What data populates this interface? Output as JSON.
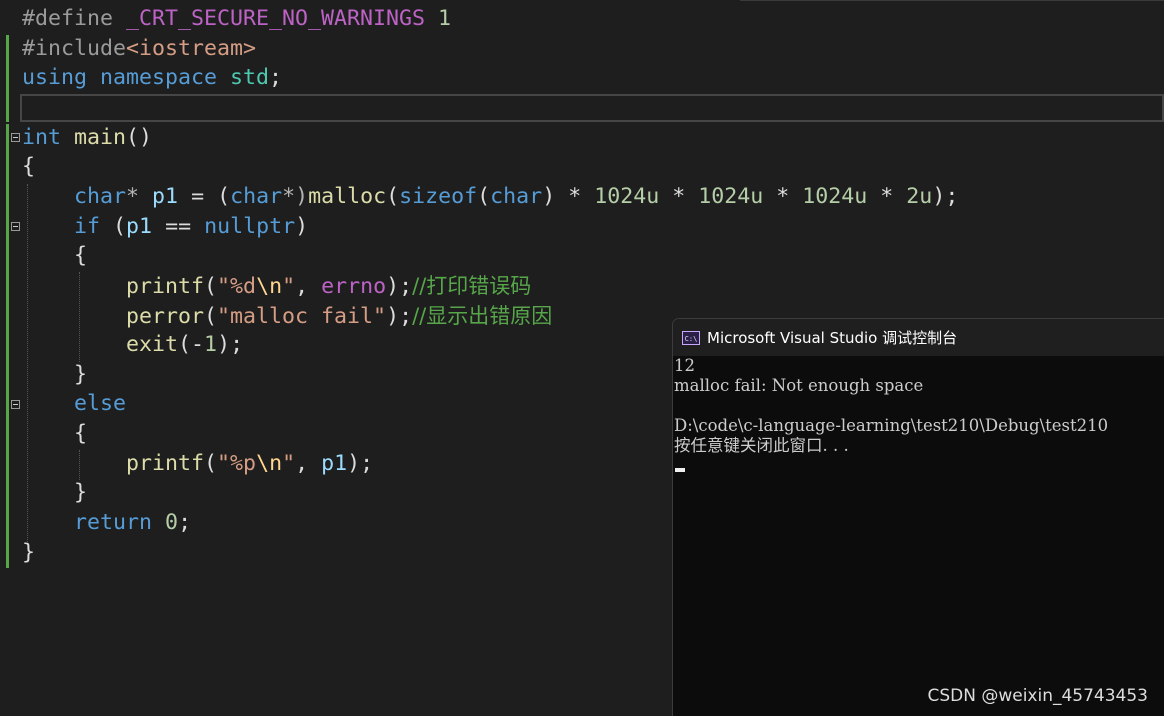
{
  "editor": {
    "lines": [
      [
        {
          "t": "#define ",
          "c": "pp"
        },
        {
          "t": "_CRT_SECURE_NO_WARNINGS",
          "c": "mac"
        },
        {
          "t": " 1",
          "c": "num"
        }
      ],
      [
        {
          "t": "#include",
          "c": "pp"
        },
        {
          "t": "<iostream>",
          "c": "str"
        }
      ],
      [
        {
          "t": "using ",
          "c": "kw"
        },
        {
          "t": "namespace ",
          "c": "kw"
        },
        {
          "t": "std",
          "c": "ty"
        },
        {
          "t": ";",
          "c": ""
        }
      ],
      [],
      [
        {
          "t": "int ",
          "c": "kw"
        },
        {
          "t": "main",
          "c": "fn"
        },
        {
          "t": "()",
          "c": ""
        }
      ],
      [
        {
          "t": "{",
          "c": ""
        }
      ],
      [
        {
          "t": "    ",
          "c": ""
        },
        {
          "t": "char",
          "c": "kw"
        },
        {
          "t": "* ",
          "c": "op"
        },
        {
          "t": "p1",
          "c": "var"
        },
        {
          "t": " = (",
          "c": ""
        },
        {
          "t": "char",
          "c": "kw"
        },
        {
          "t": "*)",
          "c": "op"
        },
        {
          "t": "malloc",
          "c": "fn"
        },
        {
          "t": "(",
          "c": ""
        },
        {
          "t": "sizeof",
          "c": "kw"
        },
        {
          "t": "(",
          "c": ""
        },
        {
          "t": "char",
          "c": "kw"
        },
        {
          "t": ") * ",
          "c": ""
        },
        {
          "t": "1024u",
          "c": "num"
        },
        {
          "t": " * ",
          "c": ""
        },
        {
          "t": "1024u",
          "c": "num"
        },
        {
          "t": " * ",
          "c": ""
        },
        {
          "t": "1024u",
          "c": "num"
        },
        {
          "t": " * ",
          "c": ""
        },
        {
          "t": "2u",
          "c": "num"
        },
        {
          "t": ");",
          "c": ""
        }
      ],
      [
        {
          "t": "    ",
          "c": ""
        },
        {
          "t": "if",
          "c": "kw"
        },
        {
          "t": " (",
          "c": ""
        },
        {
          "t": "p1",
          "c": "var"
        },
        {
          "t": " == ",
          "c": ""
        },
        {
          "t": "nullptr",
          "c": "kw"
        },
        {
          "t": ")",
          "c": ""
        }
      ],
      [
        {
          "t": "    {",
          "c": ""
        }
      ],
      [
        {
          "t": "        ",
          "c": ""
        },
        {
          "t": "printf",
          "c": "fn"
        },
        {
          "t": "(",
          "c": ""
        },
        {
          "t": "\"%d",
          "c": "str"
        },
        {
          "t": "\\n",
          "c": "esc"
        },
        {
          "t": "\"",
          "c": "str"
        },
        {
          "t": ", ",
          "c": ""
        },
        {
          "t": "errno",
          "c": "mac"
        },
        {
          "t": ");",
          "c": ""
        },
        {
          "t": "//打印错误码",
          "c": "cm"
        }
      ],
      [
        {
          "t": "        ",
          "c": ""
        },
        {
          "t": "perror",
          "c": "fn"
        },
        {
          "t": "(",
          "c": ""
        },
        {
          "t": "\"malloc fail\"",
          "c": "str"
        },
        {
          "t": ");",
          "c": ""
        },
        {
          "t": "//显示出错原因",
          "c": "cm"
        }
      ],
      [
        {
          "t": "        ",
          "c": ""
        },
        {
          "t": "exit",
          "c": "fn"
        },
        {
          "t": "(-",
          "c": ""
        },
        {
          "t": "1",
          "c": "num"
        },
        {
          "t": ");",
          "c": ""
        }
      ],
      [
        {
          "t": "    }",
          "c": ""
        }
      ],
      [
        {
          "t": "    ",
          "c": ""
        },
        {
          "t": "else",
          "c": "kw"
        }
      ],
      [
        {
          "t": "    {",
          "c": ""
        }
      ],
      [
        {
          "t": "        ",
          "c": ""
        },
        {
          "t": "printf",
          "c": "fn"
        },
        {
          "t": "(",
          "c": ""
        },
        {
          "t": "\"%p",
          "c": "str"
        },
        {
          "t": "\\n",
          "c": "esc"
        },
        {
          "t": "\"",
          "c": "str"
        },
        {
          "t": ", ",
          "c": ""
        },
        {
          "t": "p1",
          "c": "var"
        },
        {
          "t": ");",
          "c": ""
        }
      ],
      [
        {
          "t": "    }",
          "c": ""
        }
      ],
      [
        {
          "t": "    ",
          "c": ""
        },
        {
          "t": "return",
          "c": "kw"
        },
        {
          "t": " ",
          "c": ""
        },
        {
          "t": "0",
          "c": "num"
        },
        {
          "t": ";",
          "c": ""
        }
      ],
      [
        {
          "t": "}",
          "c": ""
        }
      ]
    ]
  },
  "console": {
    "title": "Microsoft Visual Studio 调试控制台",
    "icon_text": "C:\\",
    "output": [
      "12",
      "malloc fail: Not enough space",
      "",
      "D:\\code\\c-language-learning\\test210\\Debug\\test210",
      "按任意键关闭此窗口. . ."
    ]
  },
  "watermark": "CSDN @weixin_45743453"
}
